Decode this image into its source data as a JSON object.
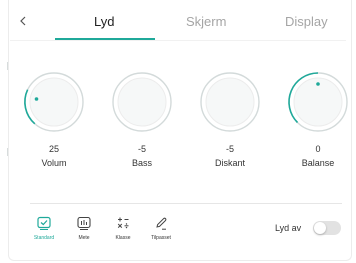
{
  "colors": {
    "accent": "#1fa99a",
    "inactive_tab": "#a5a5a5",
    "knob_ring": "#d3dada",
    "toggle_off": "#e2e2e2"
  },
  "header": {
    "back_icon": "chevron-left-icon",
    "tabs": [
      {
        "label": "Lyd",
        "active": true
      },
      {
        "label": "Skjerm",
        "active": false
      },
      {
        "label": "Display",
        "active": false
      }
    ]
  },
  "knobs": [
    {
      "label": "Volum",
      "value": "25"
    },
    {
      "label": "Bass",
      "value": "-5"
    },
    {
      "label": "Diskant",
      "value": "-5"
    },
    {
      "label": "Balanse",
      "value": "0"
    }
  ],
  "presets": [
    {
      "label": "Standard",
      "icon": "check-box-icon",
      "active": true
    },
    {
      "label": "Mete",
      "icon": "equalizer-icon",
      "active": false
    },
    {
      "label": "Klasse",
      "icon": "math-operators-icon",
      "active": false
    },
    {
      "label": "Tilpasset",
      "icon": "pencil-icon",
      "active": false
    }
  ],
  "mute": {
    "label": "Lyd av",
    "enabled": false
  }
}
